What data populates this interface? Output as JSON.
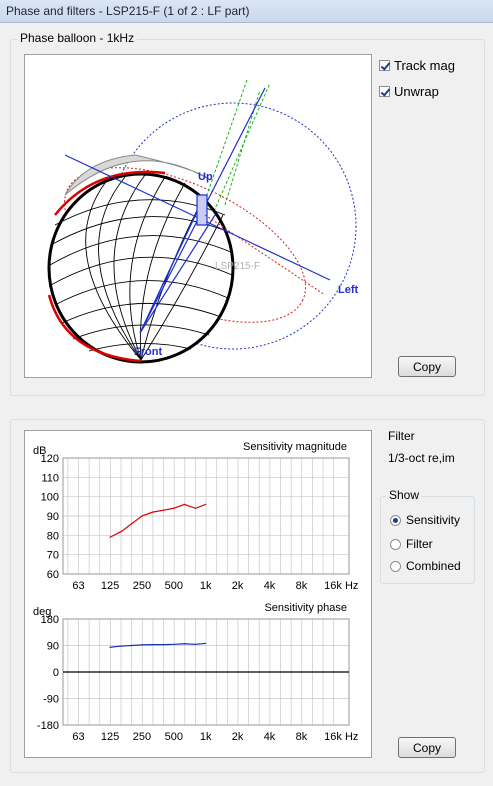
{
  "window": {
    "title": "Phase and filters - LSP215-F (1 of 2 : LF part)"
  },
  "balloon": {
    "group_label": "Phase balloon - 1kHz",
    "axis_labels": {
      "up": "Up",
      "left": "Left",
      "front": "Front",
      "ghost": "LSP215-F"
    },
    "track_mag_label": "Track mag",
    "track_mag_checked": true,
    "unwrap_label": "Unwrap",
    "unwrap_checked": true,
    "copy_label": "Copy"
  },
  "filter": {
    "label": "Filter",
    "value": "1/3-oct re,im"
  },
  "show": {
    "label": "Show",
    "options": [
      {
        "label": "Sensitivity",
        "selected": true
      },
      {
        "label": "Filter",
        "selected": false
      },
      {
        "label": "Combined",
        "selected": false
      }
    ]
  },
  "bottom_copy_label": "Copy",
  "colors": {
    "magnitude": "#dd0000",
    "phase": "#1a2fb0",
    "balloon_axis": "#1f2fd0",
    "grid": "#c8c8c8"
  },
  "chart_data": [
    {
      "type": "line",
      "title": "Sensitivity magnitude",
      "ylabel": "dB",
      "xscale": "log",
      "xticks": [
        63,
        125,
        250,
        500,
        1000,
        2000,
        4000,
        8000,
        16000
      ],
      "xtick_labels": [
        "63",
        "125",
        "250",
        "500",
        "1k",
        "2k",
        "4k",
        "8k",
        "16k Hz"
      ],
      "ylim": [
        60,
        120
      ],
      "yticks": [
        60,
        70,
        80,
        90,
        100,
        110,
        120
      ],
      "grid": true,
      "series": [
        {
          "color": "#dd0000",
          "x": [
            125,
            160,
            200,
            250,
            315,
            400,
            500,
            630,
            800,
            1000
          ],
          "y": [
            79,
            82,
            86,
            90,
            92,
            93,
            94,
            96,
            94,
            96
          ]
        }
      ]
    },
    {
      "type": "line",
      "title": "Sensitivity phase",
      "ylabel": "deg",
      "xscale": "log",
      "xticks": [
        63,
        125,
        250,
        500,
        1000,
        2000,
        4000,
        8000,
        16000
      ],
      "xtick_labels": [
        "63",
        "125",
        "250",
        "500",
        "1k",
        "2k",
        "4k",
        "8k",
        "16k Hz"
      ],
      "ylim": [
        -180,
        180
      ],
      "yticks": [
        -180,
        -90,
        0,
        90,
        180
      ],
      "zero_line": true,
      "grid": true,
      "series": [
        {
          "color": "#1a2fb0",
          "x": [
            125,
            160,
            200,
            250,
            315,
            400,
            500,
            630,
            800,
            1000
          ],
          "y": [
            84,
            88,
            90,
            92,
            93,
            93,
            94,
            96,
            94,
            97
          ]
        }
      ]
    }
  ]
}
